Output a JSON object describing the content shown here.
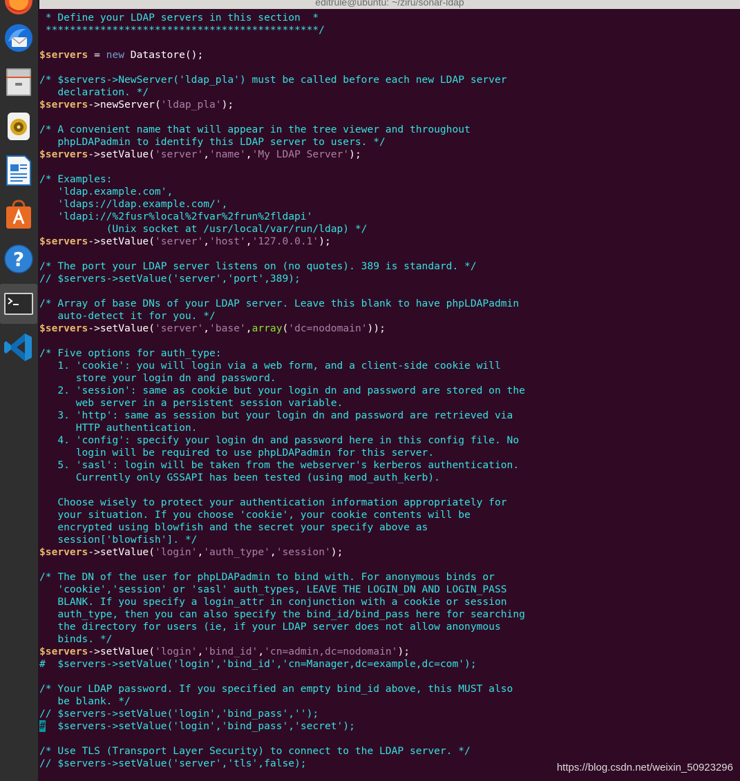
{
  "window": {
    "title": "editrule@ubuntu: ~/ziru/sonar-ldap"
  },
  "dock": {
    "items": [
      "firefox-icon",
      "thunderbird-icon",
      "files-icon",
      "rhythmbox-icon",
      "libreoffice-writer-icon",
      "software-center-icon",
      "help-icon",
      "terminal-icon",
      "vscode-icon"
    ],
    "active": "terminal-icon"
  },
  "editor": {
    "cursor_line": 57,
    "lines": [
      " * Define your LDAP servers in this section  *",
      " *********************************************/",
      "",
      "$servers = new Datastore();",
      "",
      "/* $servers->NewServer('ldap_pla') must be called before each new LDAP server",
      "   declaration. */",
      "$servers->newServer('ldap_pla');",
      "",
      "/* A convenient name that will appear in the tree viewer and throughout",
      "   phpLDAPadmin to identify this LDAP server to users. */",
      "$servers->setValue('server','name','My LDAP Server');",
      "",
      "/* Examples:",
      "   'ldap.example.com',",
      "   'ldaps://ldap.example.com/',",
      "   'ldapi://%2fusr%local%2fvar%2frun%2fldapi'",
      "           (Unix socket at /usr/local/var/run/ldap) */",
      "$servers->setValue('server','host','127.0.0.1');",
      "",
      "/* The port your LDAP server listens on (no quotes). 389 is standard. */",
      "// $servers->setValue('server','port',389);",
      "",
      "/* Array of base DNs of your LDAP server. Leave this blank to have phpLDAPadmin",
      "   auto-detect it for you. */",
      "$servers->setValue('server','base',array('dc=nodomain'));",
      "",
      "/* Five options for auth_type:",
      "   1. 'cookie': you will login via a web form, and a client-side cookie will",
      "      store your login dn and password.",
      "   2. 'session': same as cookie but your login dn and password are stored on the",
      "      web server in a persistent session variable.",
      "   3. 'http': same as session but your login dn and password are retrieved via",
      "      HTTP authentication.",
      "   4. 'config': specify your login dn and password here in this config file. No",
      "      login will be required to use phpLDAPadmin for this server.",
      "   5. 'sasl': login will be taken from the webserver's kerberos authentication.",
      "      Currently only GSSAPI has been tested (using mod_auth_kerb).",
      "",
      "   Choose wisely to protect your authentication information appropriately for",
      "   your situation. If you choose 'cookie', your cookie contents will be",
      "   encrypted using blowfish and the secret your specify above as",
      "   session['blowfish']. */",
      "$servers->setValue('login','auth_type','session');",
      "",
      "/* The DN of the user for phpLDAPadmin to bind with. For anonymous binds or",
      "   'cookie','session' or 'sasl' auth_types, LEAVE THE LOGIN_DN AND LOGIN_PASS",
      "   BLANK. If you specify a login_attr in conjunction with a cookie or session",
      "   auth_type, then you can also specify the bind_id/bind_pass here for searching",
      "   the directory for users (ie, if your LDAP server does not allow anonymous",
      "   binds. */",
      "$servers->setValue('login','bind_id','cn=admin,dc=nodomain');",
      "#  $servers->setValue('login','bind_id','cn=Manager,dc=example,dc=com');",
      "",
      "/* Your LDAP password. If you specified an empty bind_id above, this MUST also",
      "   be blank. */",
      "// $servers->setValue('login','bind_pass','');",
      "#  $servers->setValue('login','bind_pass','secret');",
      "",
      "/* Use TLS (Transport Layer Security) to connect to the LDAP server. */",
      "// $servers->setValue('server','tls',false);"
    ]
  },
  "watermark": "https://blog.csdn.net/weixin_50923296",
  "colors": {
    "background": "#300a24",
    "comment": "#34e2e2",
    "variable": "#e9b96e",
    "string": "#ad7fa8",
    "function": "#8ae234",
    "keyword": "#729fcf"
  }
}
